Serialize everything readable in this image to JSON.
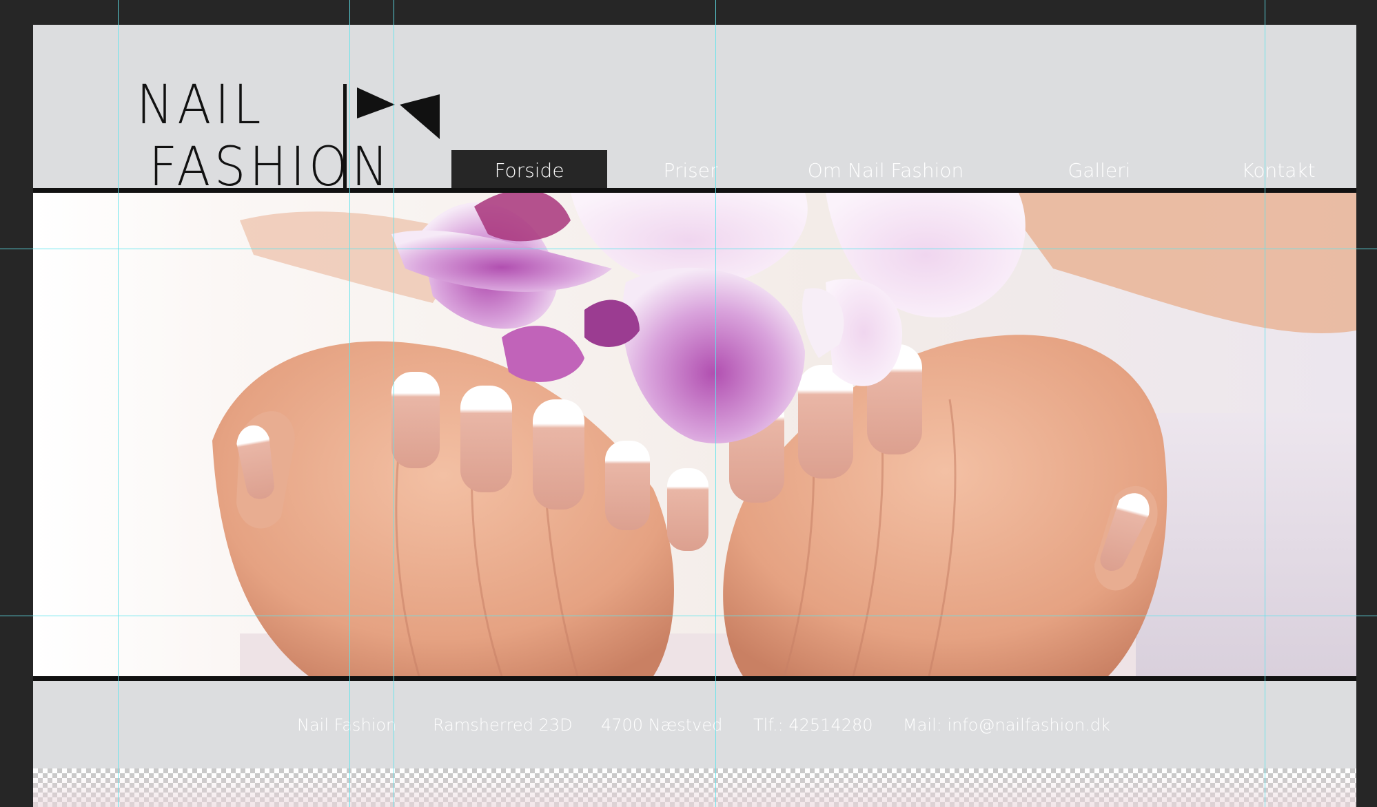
{
  "brand": {
    "logo_line1": "NAIL",
    "logo_line2": "FASHION",
    "logo_colors": {
      "text": "#111111"
    }
  },
  "nav": {
    "items": [
      {
        "label": "Forside",
        "active": true
      },
      {
        "label": "Priser",
        "active": false
      },
      {
        "label": "Om Nail Fashion",
        "active": false
      },
      {
        "label": "Galleri",
        "active": false
      },
      {
        "label": "Kontakt",
        "active": false
      }
    ]
  },
  "hero": {
    "image_icon": "hands-with-orchid-photo"
  },
  "footer": {
    "name": "Nail Fashion",
    "address": "Ramsherred 23D",
    "city": "4700 Næstved",
    "phone": "Tlf.: 42514280",
    "email": "Mail: info@nailfashion.dk"
  },
  "colors": {
    "canvas": "#262626",
    "page": "#dcdddf",
    "nav_active": "#262626",
    "nav_text": "#ffffff",
    "rule": "#111111",
    "guides": "#5fe3ec"
  }
}
